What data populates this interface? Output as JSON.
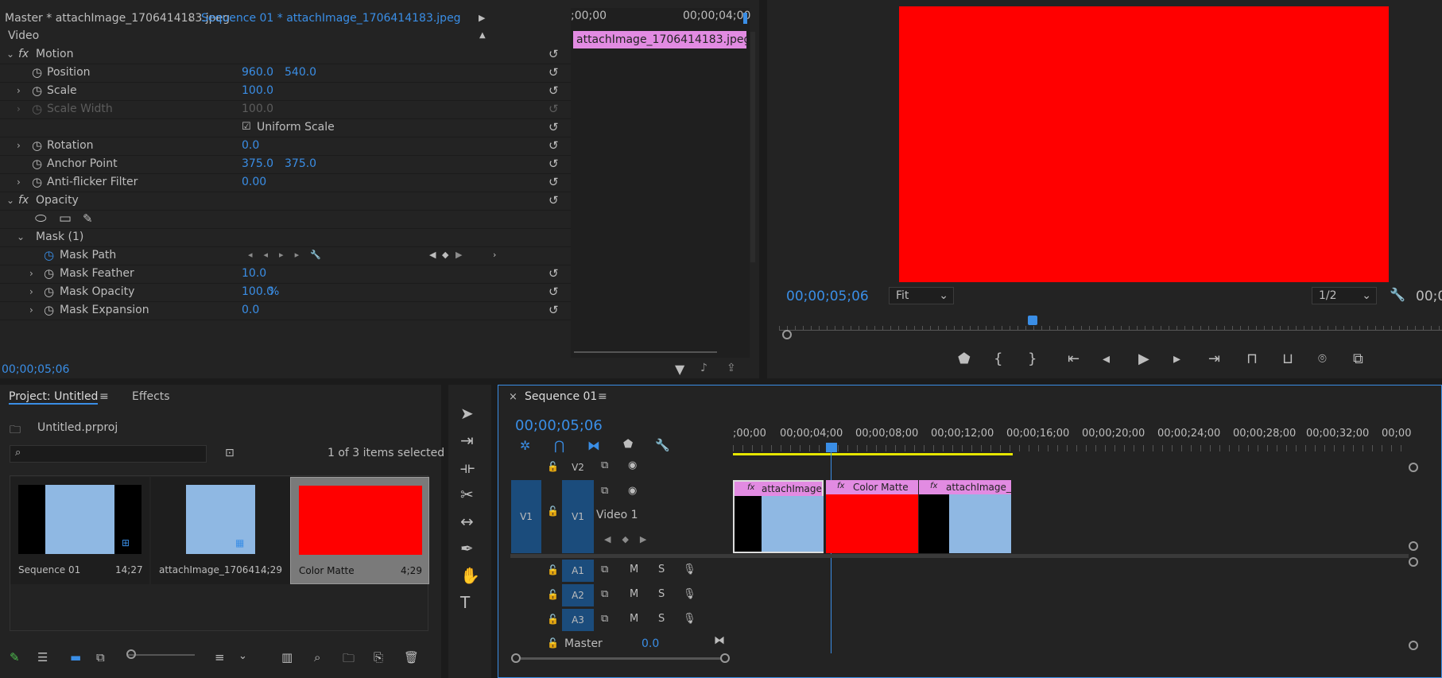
{
  "effect_controls": {
    "tab_master": "Master * attachImage_1706414183.jpeg",
    "tab_sequence": "Sequence 01 * attachImage_1706414183.jpeg",
    "section": "Video",
    "motion": "Motion",
    "position_label": "Position",
    "position_x": "960.0",
    "position_y": "540.0",
    "scale_label": "Scale",
    "scale_val": "100.0",
    "scale_width_label": "Scale Width",
    "scale_width_val": "100.0",
    "uniform_scale": "Uniform Scale",
    "rotation_label": "Rotation",
    "rotation_val": "0.0",
    "anchor_label": "Anchor Point",
    "anchor_x": "375.0",
    "anchor_y": "375.0",
    "antiflicker_label": "Anti-flicker Filter",
    "antiflicker_val": "0.00",
    "opacity": "Opacity",
    "mask": "Mask (1)",
    "mask_path": "Mask Path",
    "mask_feather_label": "Mask Feather",
    "mask_feather_val": "10.0",
    "mask_opacity_label": "Mask Opacity",
    "mask_opacity_val": "100.0",
    "mask_opacity_unit": "%",
    "mask_expansion_label": "Mask Expansion",
    "mask_expansion_val": "0.0",
    "tl_time_start": ";00;00",
    "tl_time_end": "00;00;04;00",
    "clip_name": "attachImage_1706414183.jpeg",
    "timecode": "00;00;05;06"
  },
  "program_monitor": {
    "timecode": "00;00;05;06",
    "fit": "Fit",
    "resolution": "1/2",
    "right_tc": "00;0"
  },
  "project": {
    "tab": "Project: Untitled",
    "effects_tab": "Effects",
    "file": "Untitled.prproj",
    "search_placeholder": "",
    "selection": "1 of 3 items selected",
    "items": [
      {
        "name": "Sequence 01",
        "dur": "14;27"
      },
      {
        "name": "attachImage_170641...",
        "dur": "4;29"
      },
      {
        "name": "Color Matte",
        "dur": "4;29"
      }
    ]
  },
  "timeline": {
    "tab": "Sequence 01",
    "timecode": "00;00;05;06",
    "ruler": [
      ";00;00",
      "00;00;04;00",
      "00;00;08;00",
      "00;00;12;00",
      "00;00;16;00",
      "00;00;20;00",
      "00;00;24;00",
      "00;00;28;00",
      "00;00;32;00",
      "00;00"
    ],
    "v2": "V2",
    "v1": "V1",
    "v1_src": "V1",
    "video1": "Video 1",
    "a1": "A1",
    "a2": "A2",
    "a3": "A3",
    "m": "M",
    "s": "S",
    "master": "Master",
    "master_val": "0.0",
    "clips": [
      {
        "name": "attachImage"
      },
      {
        "name": "Color Matte"
      },
      {
        "name": "attachImage_1"
      }
    ]
  }
}
